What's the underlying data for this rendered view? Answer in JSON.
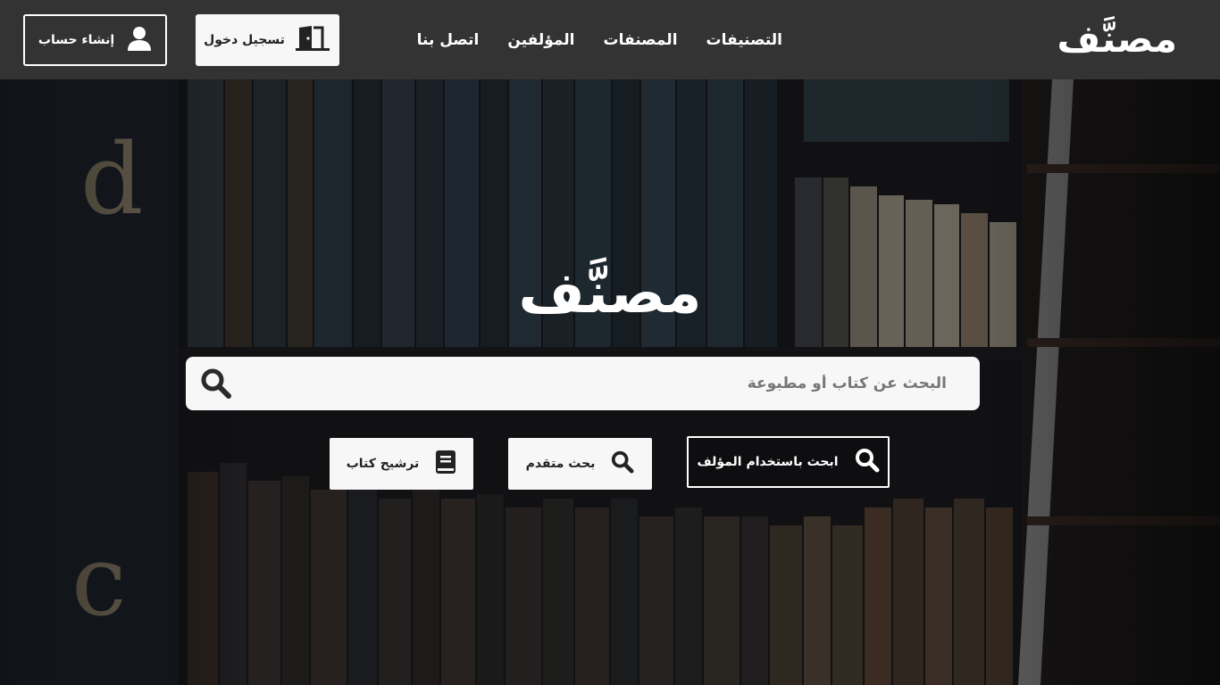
{
  "header": {
    "logo": "مصنَّف",
    "nav": [
      {
        "label": "التصنيفات",
        "icon": null
      },
      {
        "label": "المصنفات"
      },
      {
        "label": "المؤلفين"
      },
      {
        "label": "اتصل بنا"
      }
    ],
    "login_label": "تسجيل دخول",
    "login_icon": "door-icon",
    "signup_label": "إنشاء حساب",
    "signup_icon": "user-icon"
  },
  "hero": {
    "title": "مصنَّف",
    "search_placeholder": "البحث عن كتاب أو مطبوعة",
    "search_icon": "search-icon",
    "actions": {
      "author_search": "ابحث باستخدام المؤلف",
      "advanced_search": "بحث متقدم",
      "nominate_book": "ترشيح كتاب"
    },
    "background_letters": [
      "d",
      "c"
    ]
  },
  "colors": {
    "header_bg": "#333333",
    "button_light": "#f7f7f7",
    "text_dark": "#222222",
    "text_light": "#ffffff"
  }
}
